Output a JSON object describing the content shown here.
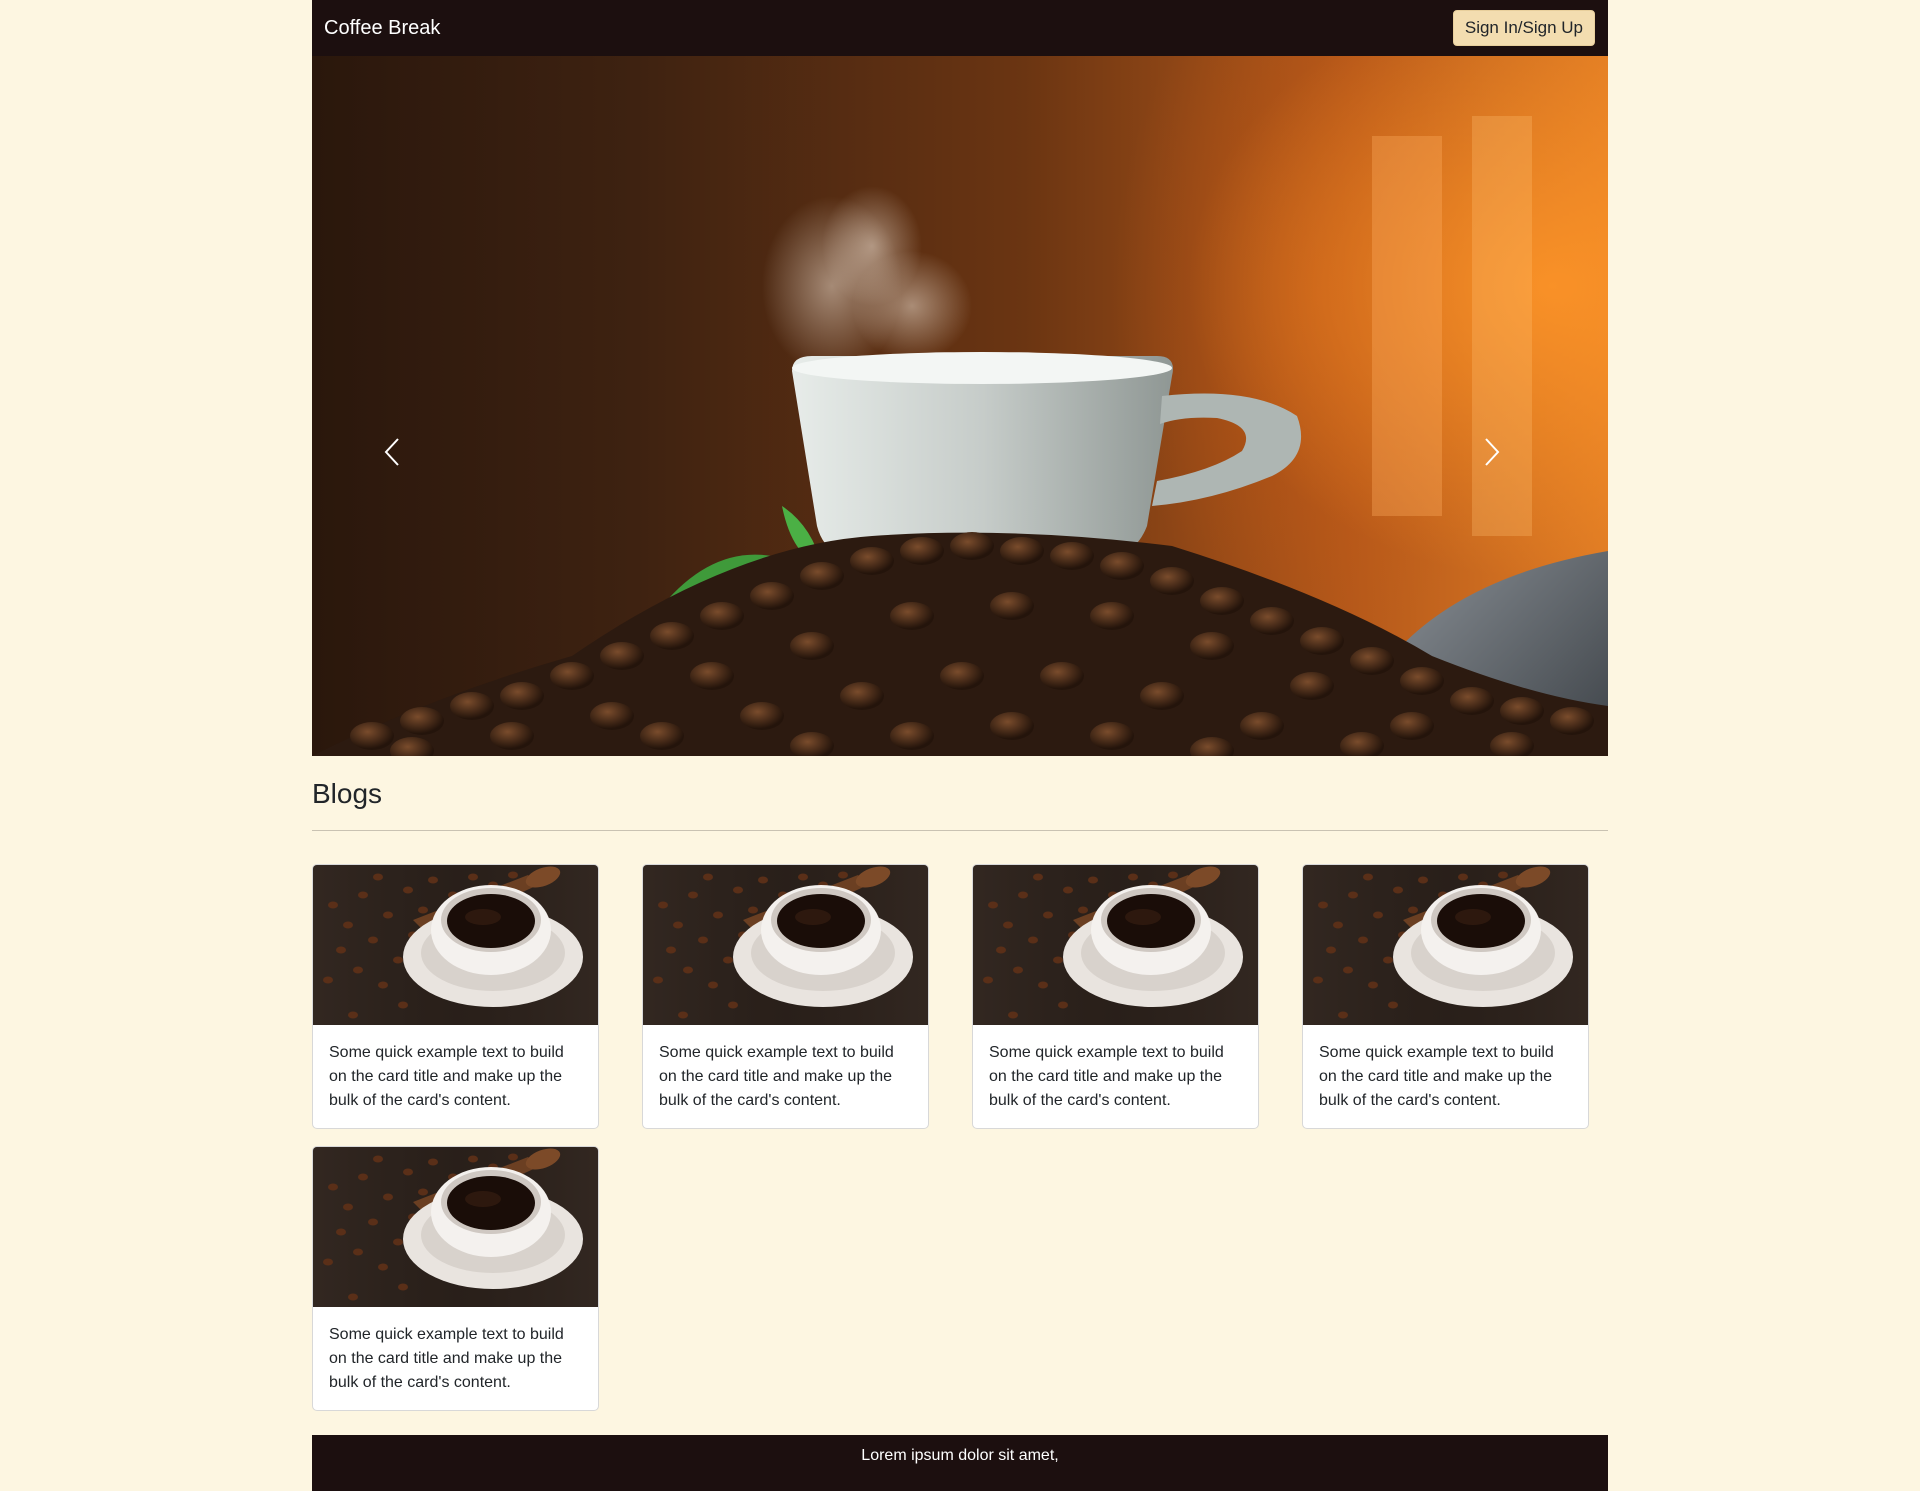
{
  "navbar": {
    "brand": "Coffee Break",
    "signin_label": "Sign In/Sign Up"
  },
  "hero": {
    "image_icon": "coffee-cup-on-beans-image",
    "prev_icon": "chevron-left-icon",
    "next_icon": "chevron-right-icon"
  },
  "blogs": {
    "title": "Blogs",
    "cards": [
      {
        "text": "Some quick example text to build on the card title and make up the bulk of the card's content."
      },
      {
        "text": "Some quick example text to build on the card title and make up the bulk of the card's content."
      },
      {
        "text": "Some quick example text to build on the card title and make up the bulk of the card's content."
      },
      {
        "text": "Some quick example text to build on the card title and make up the bulk of the card's content."
      },
      {
        "text": "Some quick example text to build on the card title and make up the bulk of the card's content."
      }
    ]
  },
  "footer": {
    "text": "Lorem ipsum dolor sit amet,"
  },
  "colors": {
    "page_bg": "#fdf6e1",
    "nav_bg": "#1c0f0f",
    "button_bg": "#f3ddb0"
  }
}
